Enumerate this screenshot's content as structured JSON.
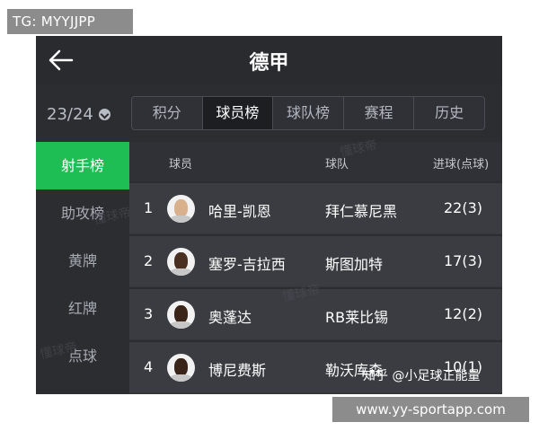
{
  "corner_tag": "TG: MYYJJPP",
  "header": {
    "title": "德甲"
  },
  "season": {
    "label": "23/24"
  },
  "tabs": [
    {
      "label": "积分",
      "active": false
    },
    {
      "label": "球员榜",
      "active": true
    },
    {
      "label": "球队榜",
      "active": false
    },
    {
      "label": "赛程",
      "active": false
    },
    {
      "label": "历史",
      "active": false
    }
  ],
  "sidebar": {
    "items": [
      {
        "label": "射手榜",
        "active": true
      },
      {
        "label": "助攻榜",
        "active": false
      },
      {
        "label": "黄牌",
        "active": false
      },
      {
        "label": "红牌",
        "active": false
      },
      {
        "label": "点球",
        "active": false
      }
    ]
  },
  "table": {
    "headers": {
      "player": "球员",
      "team": "球队",
      "goals": "进球(点球)"
    },
    "rows": [
      {
        "rank": "1",
        "player": "哈里-凯恩",
        "team": "拜仁慕尼黑",
        "goals": "22(3)"
      },
      {
        "rank": "2",
        "player": "塞罗-吉拉西",
        "team": "斯图加特",
        "goals": "17(3)"
      },
      {
        "rank": "3",
        "player": "奥蓬达",
        "team": "RB莱比锡",
        "goals": "12(2)"
      },
      {
        "rank": "4",
        "player": "博尼费斯",
        "team": "勒沃库森",
        "goals": "10(1)"
      }
    ]
  },
  "watermark_text": "懂球帝",
  "caption": "知乎 @小足球正能量",
  "site_tag": "www.yy-sportapp.com",
  "colors": {
    "accent": "#1fbe55",
    "background": "#2b2d31",
    "row": "#3a3c42"
  },
  "icons": {
    "back": "arrow-left-icon",
    "season_dropdown": "chevron-down-icon"
  }
}
